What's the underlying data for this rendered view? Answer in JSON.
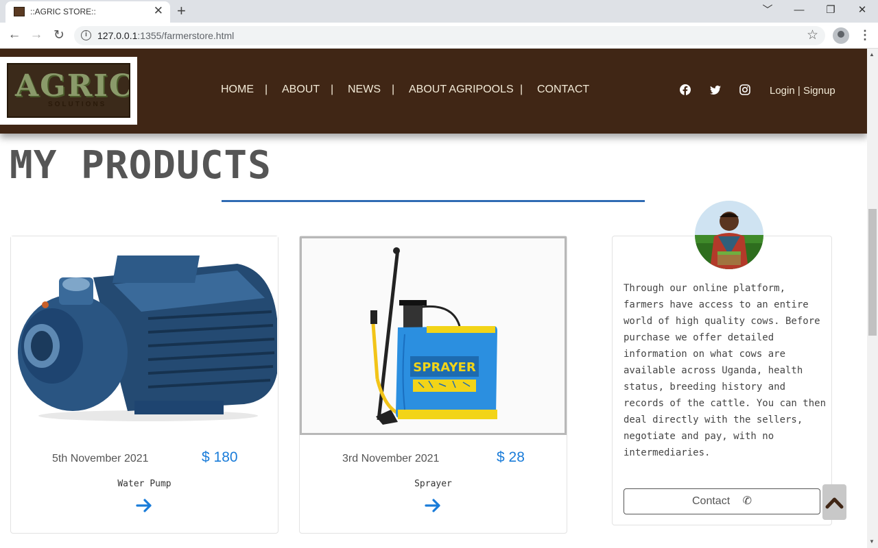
{
  "browser": {
    "tab_title": "::AGRIC STORE::",
    "tab_close": "✕",
    "new_tab": "+",
    "url_host": "127.0.0.1",
    "url_rest": ":1355/farmerstore.html",
    "window_controls": [
      "﹀",
      "—",
      "❐",
      "✕"
    ]
  },
  "header": {
    "logo_text": "AGRIC",
    "logo_sub": "SOLUTIONS",
    "nav": [
      "HOME",
      "ABOUT",
      "NEWS",
      "ABOUT AGRIPOOLS",
      "CONTACT"
    ],
    "separator": "|",
    "login": "Login",
    "signup": "Signup",
    "auth_sep": "|"
  },
  "page": {
    "heading": "MY PRODUCTS"
  },
  "products": [
    {
      "date": "5th November 2021",
      "price": "$ 180",
      "name": "Water Pump"
    },
    {
      "date": "3rd November 2021",
      "price": "$ 28",
      "name": "Sprayer"
    }
  ],
  "sprayer_label": "SPRAYER",
  "profile": {
    "text": "Through our online platform, farmers have access to an entire world of high quality cows. Before purchase we offer detailed information on what cows are available across Uganda, health status, breeding history and records of the cattle. You can then deal directly with the sellers, negotiate and pay, with no intermediaries.",
    "contact_label": "Contact"
  },
  "colors": {
    "header_bg": "#402615",
    "accent_blue": "#1a7cd9",
    "heading_line": "#2f6bb3"
  }
}
